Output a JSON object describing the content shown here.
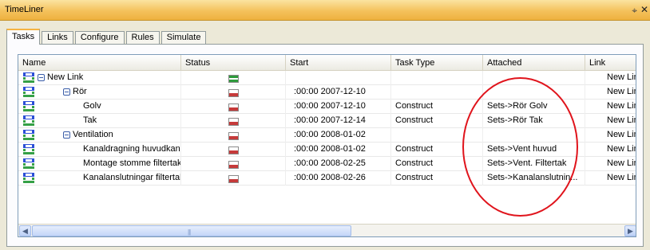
{
  "window": {
    "title": "TimeLiner"
  },
  "tabs": [
    {
      "label": "Tasks",
      "active": true
    },
    {
      "label": "Links",
      "active": false
    },
    {
      "label": "Configure",
      "active": false
    },
    {
      "label": "Rules",
      "active": false
    },
    {
      "label": "Simulate",
      "active": false
    }
  ],
  "columns": {
    "name": "Name",
    "status": "Status",
    "start": "Start",
    "task_type": "Task Type",
    "attached": "Attached",
    "link": "Link"
  },
  "rows": [
    {
      "name": "New Link",
      "start": "",
      "task_type": "",
      "attached": "",
      "link": "New Link",
      "level": 0,
      "group": true,
      "status": "complete"
    },
    {
      "name": "Rör",
      "start": ":00:00 2007-12-10",
      "task_type": "",
      "attached": "",
      "link": "New Link",
      "level": 1,
      "group": true,
      "status": "pending"
    },
    {
      "name": "Golv",
      "start": ":00:00 2007-12-10",
      "task_type": "Construct",
      "attached": "Sets->Rör Golv",
      "link": "New Link",
      "level": 2,
      "group": false,
      "status": "pending"
    },
    {
      "name": "Tak",
      "start": ":00:00 2007-12-14",
      "task_type": "Construct",
      "attached": "Sets->Rör Tak",
      "link": "New Link",
      "level": 2,
      "group": false,
      "status": "pending"
    },
    {
      "name": "Ventilation",
      "start": ":00:00 2008-01-02",
      "task_type": "",
      "attached": "",
      "link": "New Link",
      "level": 1,
      "group": true,
      "status": "pending"
    },
    {
      "name": "Kanaldragning huvudkanaler",
      "start": ":00:00 2008-01-02",
      "task_type": "Construct",
      "attached": "Sets->Vent huvud",
      "link": "New Link",
      "level": 2,
      "group": false,
      "status": "pending"
    },
    {
      "name": "Montage stomme filtertak",
      "start": ":00:00 2008-02-25",
      "task_type": "Construct",
      "attached": "Sets->Vent. Filtertak",
      "link": "New Link",
      "level": 2,
      "group": false,
      "status": "pending"
    },
    {
      "name": "Kanalanslutningar filtertak",
      "start": ":00:00 2008-02-26",
      "task_type": "Construct",
      "attached": "Sets->Kanalanslutnin...",
      "link": "New Link",
      "level": 2,
      "group": false,
      "status": "pending"
    }
  ],
  "colors": {
    "title_bar": "#f4c15c",
    "tab_accent": "#f5b342",
    "status_complete": "#2e9b3c",
    "status_pending": "#c63a3a",
    "task_icon_blue": "#2b4fd6",
    "task_icon_green": "#35a046",
    "annotation": "#e0141c"
  },
  "icons": {
    "pin": "pin-icon",
    "close": "close-icon",
    "scroll_left": "scroll-left-arrow-icon",
    "scroll_right": "scroll-right-arrow-icon"
  }
}
